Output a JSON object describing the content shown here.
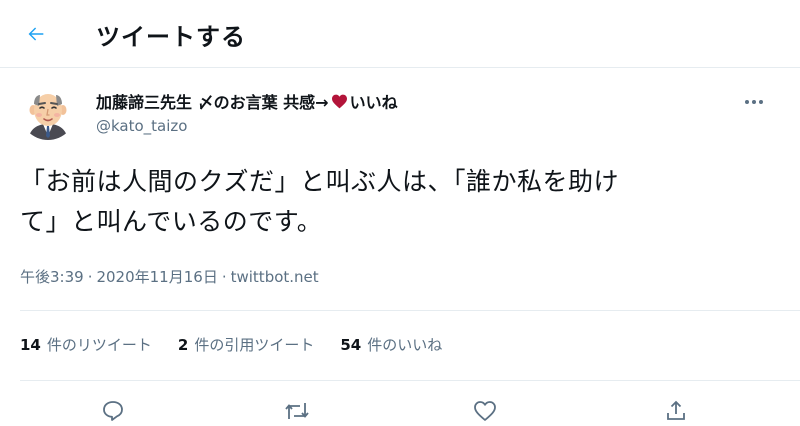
{
  "header": {
    "title": "ツイートする",
    "back_icon": "arrow-left-icon"
  },
  "tweet": {
    "display_name_prefix": "加藤諦三先生 〆のお言葉 共感→",
    "display_name_suffix": "いいね",
    "handle": "@kato_taizo",
    "text_lines": [
      "「お前は人間のクズだ」と叫ぶ人は、「誰か私を助け",
      "て」と叫んでいるのです。"
    ],
    "time": "午後3:39",
    "date": "2020年11月16日",
    "separator": "·",
    "source": "twittbot.net"
  },
  "stats": {
    "retweets": {
      "count": "14",
      "label": "件のリツイート"
    },
    "quotes": {
      "count": "2",
      "label": "件の引用ツイート"
    },
    "likes": {
      "count": "54",
      "label": "件のいいね"
    }
  },
  "colors": {
    "accent": "#1da1f2",
    "heart": "#b3143a",
    "secondary_text": "#5b7083",
    "divider": "#e6ecf0"
  },
  "icons": {
    "more": "more-dots-icon",
    "reply": "reply-icon",
    "retweet": "retweet-icon",
    "like": "heart-outline-icon",
    "share": "share-icon"
  }
}
